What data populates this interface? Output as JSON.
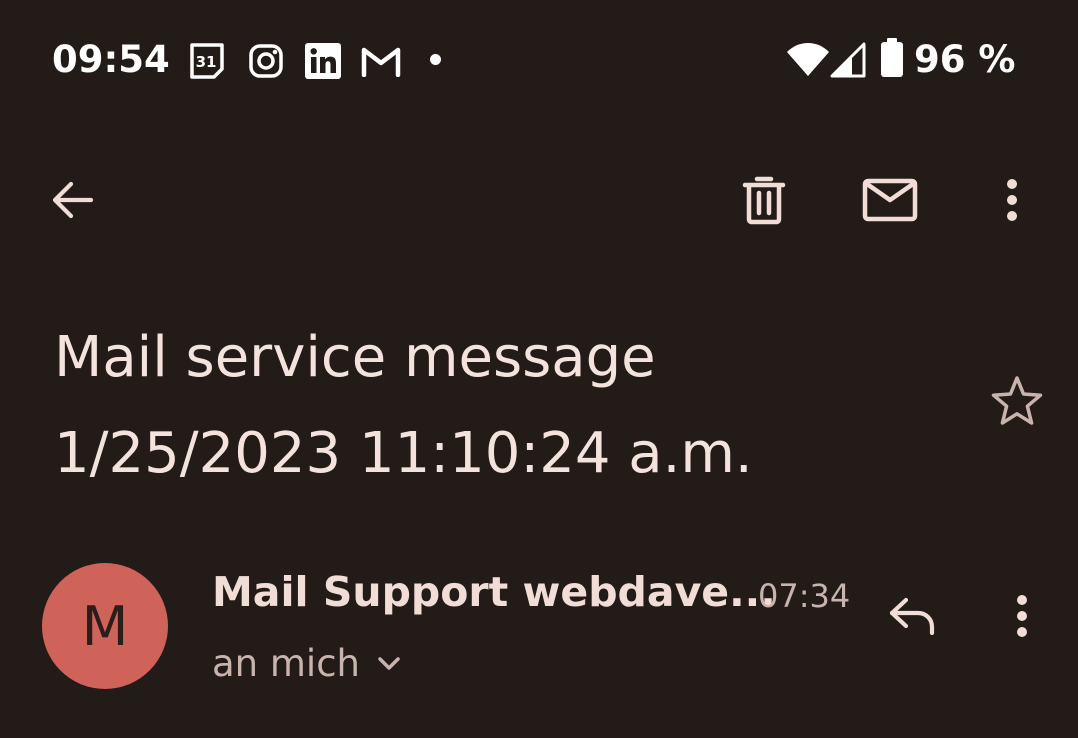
{
  "status_bar": {
    "time": "09:54",
    "calendar_badge": "31",
    "battery_percent": "96 %",
    "icons": [
      "calendar-icon",
      "instagram-icon",
      "linkedin-icon",
      "gmail-icon",
      "notification-dot",
      "wifi-icon",
      "signal-icon",
      "battery-icon"
    ]
  },
  "toolbar": {
    "icons": [
      "back-arrow-icon",
      "trash-icon",
      "mail-icon",
      "more-vert-icon"
    ]
  },
  "email": {
    "subject": "Mail service message\n1/25/2023 11:10:24 a.m.",
    "sender_initial": "M",
    "sender_name": "Mail Support webdave...",
    "time": "07:34",
    "recipient": "an mich",
    "avatar_color": "#cf6359"
  },
  "colors": {
    "background": "#231b18",
    "text": "#f1ddd6",
    "muted": "#c9b4ad"
  }
}
